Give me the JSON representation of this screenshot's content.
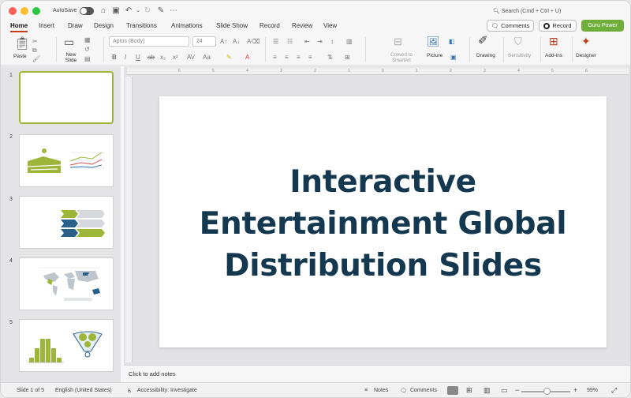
{
  "titlebar": {
    "autosave_label": "AutoSave",
    "search_placeholder": "Search (Cmd + Ctrl + U)"
  },
  "tabs": [
    "Home",
    "Insert",
    "Draw",
    "Design",
    "Transitions",
    "Animations",
    "Slide Show",
    "Record",
    "Review",
    "View"
  ],
  "actions": {
    "comments": "Comments",
    "record": "Record",
    "guru": "Guru Power"
  },
  "ribbon": {
    "paste": "Paste",
    "new_slide": "New Slide",
    "font_name": "Aptos (Body)",
    "font_size": "24",
    "convert_smartart": "Convert to SmartArt",
    "picture": "Picture",
    "drawing": "Drawing",
    "sensitivity": "Sensitivity",
    "addins": "Add-ins",
    "designer": "Designer"
  },
  "thumbnails": [
    "1",
    "2",
    "3",
    "4",
    "5"
  ],
  "ruler": [
    "6",
    "5",
    "4",
    "3",
    "2",
    "1",
    "0",
    "1",
    "2",
    "3",
    "4",
    "5",
    "6"
  ],
  "slide": {
    "title": "Interactive Entertainment Global Distribution Slides"
  },
  "notes": {
    "placeholder": "Click to add notes"
  },
  "statusbar": {
    "slide_info": "Slide 1 of 5",
    "language": "English (United States)",
    "accessibility": "Accessibility: Investigate",
    "notes": "Notes",
    "comments": "Comments",
    "zoom": "99%"
  },
  "colors": {
    "accent": "#c43e1c",
    "guru": "#6fae3b",
    "title": "#14384f",
    "selected_thumb": "#9db63a"
  }
}
